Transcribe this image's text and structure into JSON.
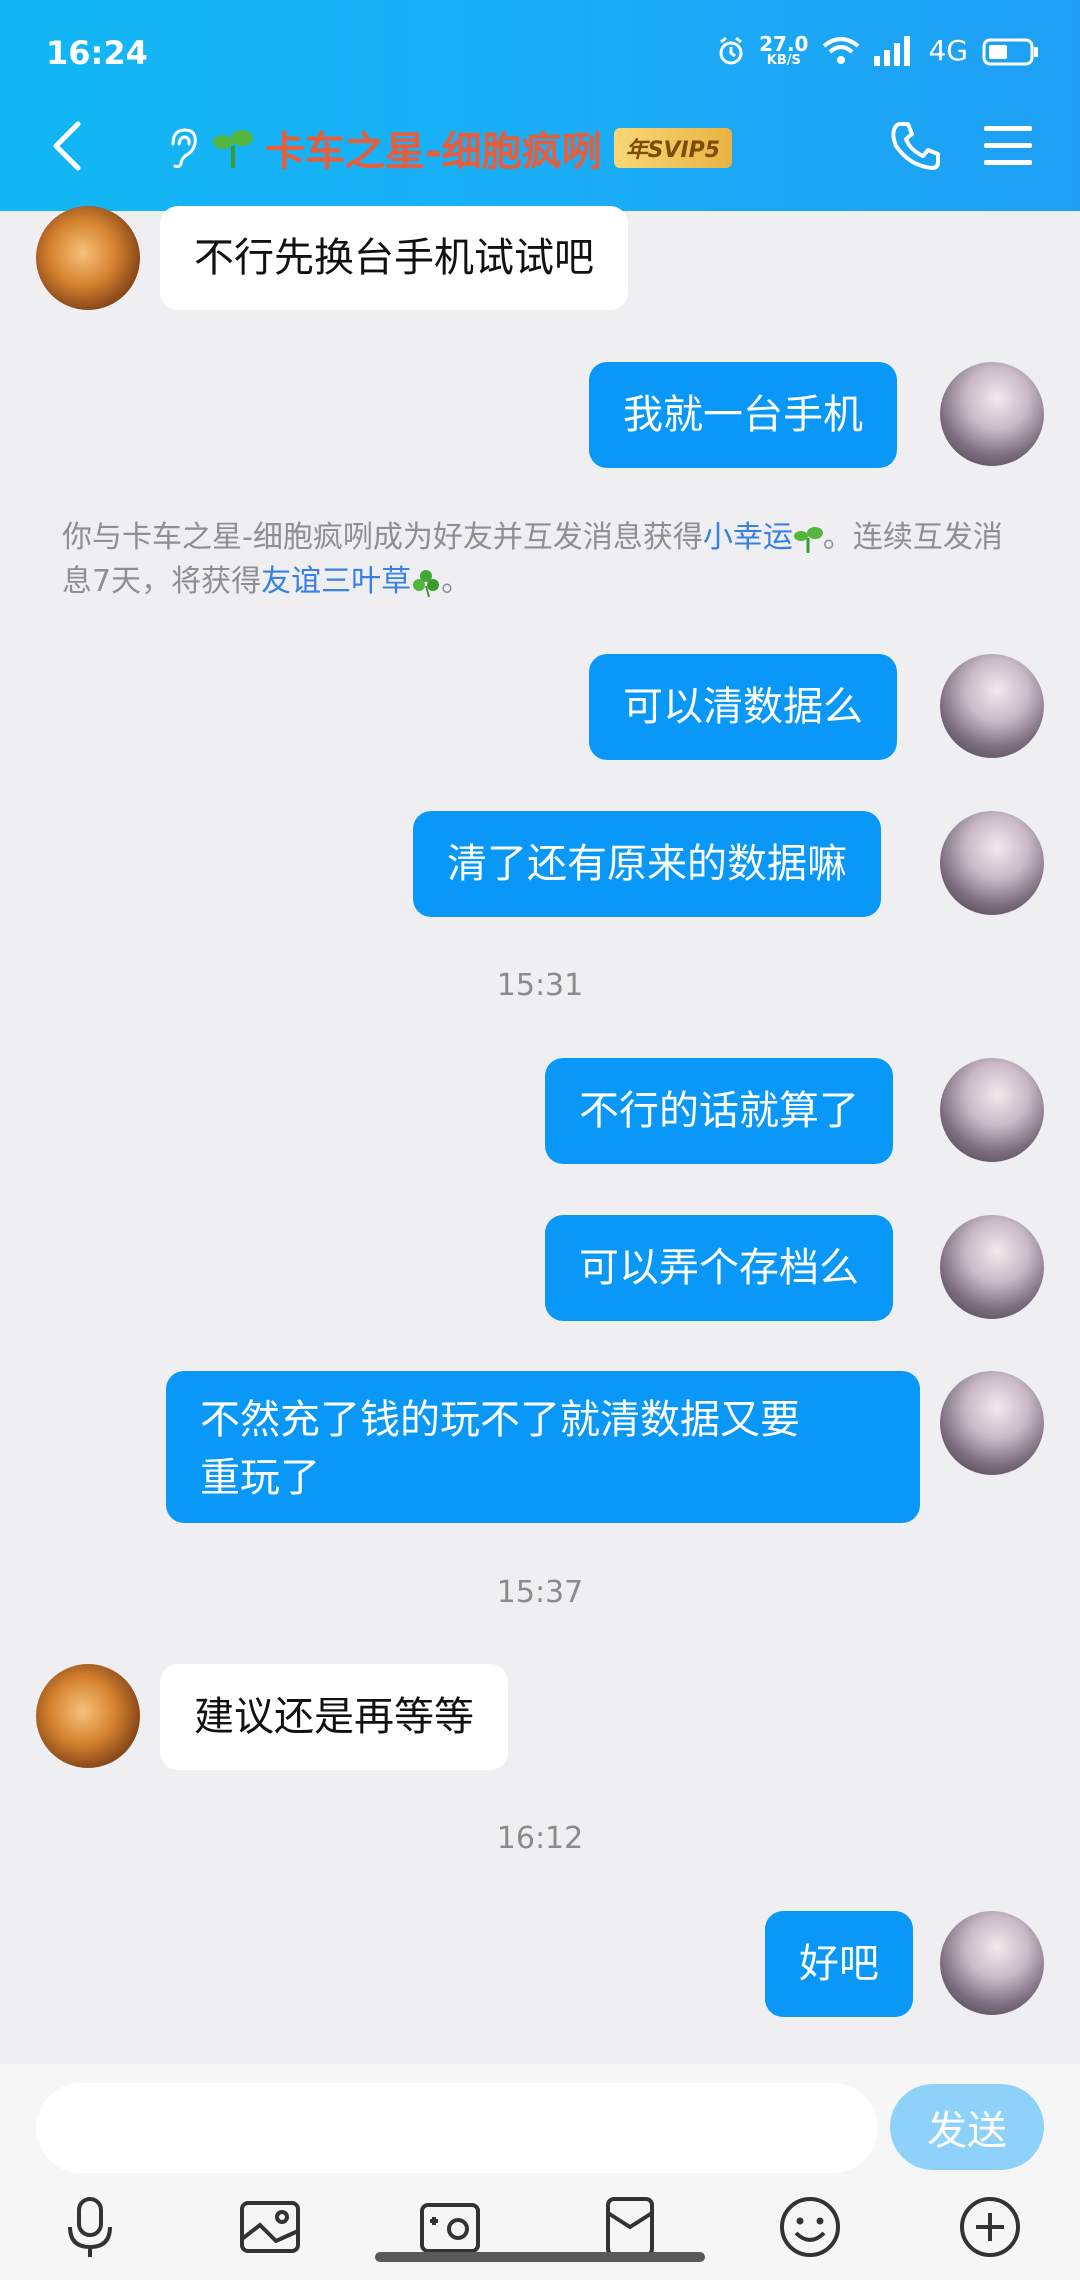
{
  "status_bar": {
    "time": "16:24",
    "net_speed": "27.0",
    "net_speed_unit": "KB/S",
    "network": "4G"
  },
  "header": {
    "title": "卡车之星-细胞疯咧",
    "vip_badge": "年SVIP5"
  },
  "messages": [
    {
      "side": "in",
      "text": "不行先换台手机试试吧"
    },
    {
      "side": "out",
      "text": "我就一台手机"
    },
    {
      "side": "out",
      "text": "可以清数据么"
    },
    {
      "side": "out",
      "text": "清了还有原来的数据嘛"
    },
    {
      "side": "out",
      "text": "不行的话就算了"
    },
    {
      "side": "out",
      "text": "可以弄个存档么"
    },
    {
      "side": "out",
      "text_line1": "不然充了钱的玩不了就清数据又要",
      "text_line2": "重玩了"
    },
    {
      "side": "in",
      "text": "建议还是再等等"
    },
    {
      "side": "out",
      "text": "好吧"
    }
  ],
  "system_notice": {
    "part1": "你与卡车之星-细胞疯咧成为好友并互发消息获得",
    "link1": "小幸运",
    "part2": "。连续互发消息7天，将获得",
    "link2": "友谊三叶草",
    "part3": "。"
  },
  "timestamps": [
    "15:31",
    "15:37",
    "16:12"
  ],
  "input": {
    "value": "",
    "send_label": "发送"
  },
  "toolbar_icons": [
    "microphone-icon",
    "image-icon",
    "camera-icon",
    "red-packet-icon",
    "emoji-icon",
    "plus-icon"
  ],
  "colors": {
    "header_blue": "#12b7f5",
    "bubble_out": "#0998f7",
    "link": "#3680e6",
    "title": "#e85d3a"
  }
}
